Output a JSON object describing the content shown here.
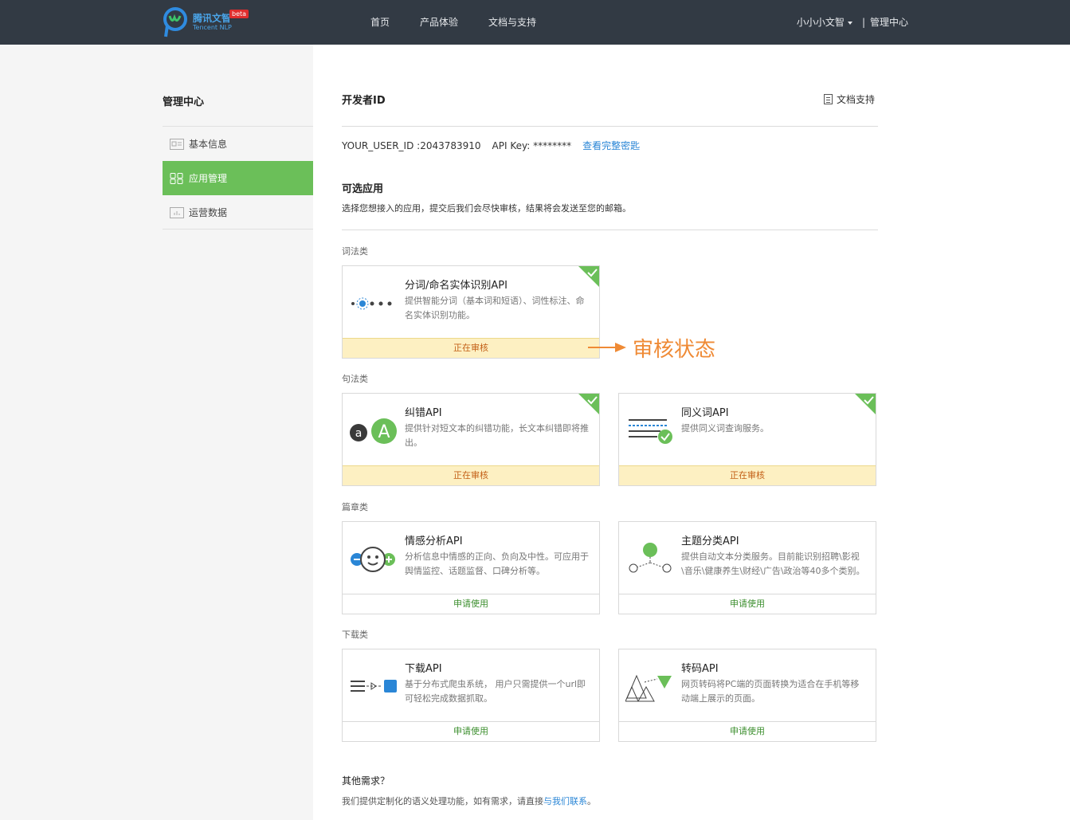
{
  "header": {
    "logo_text": "腾讯文智",
    "logo_sub": "Tencent NLP",
    "logo_badge": "beta",
    "nav": [
      "首页",
      "产品体验",
      "文档与支持"
    ],
    "username": "小小小文智",
    "separator": "|",
    "admin_link": "管理中心"
  },
  "sidebar": {
    "title": "管理中心",
    "items": [
      {
        "label": "基本信息",
        "icon": "id-card-icon"
      },
      {
        "label": "应用管理",
        "icon": "grid-icon"
      },
      {
        "label": "运营数据",
        "icon": "chart-icon"
      }
    ]
  },
  "content": {
    "title": "开发者ID",
    "doc_link": "文档支持",
    "user_id": "YOUR_USER_ID :2043783910",
    "api_key": "API Key: ********",
    "view_key": "查看完整密匙",
    "section_title": "可选应用",
    "section_desc": "选择您想接入的应用，提交后我们会尽快审核，结果将会发送至您的邮箱。",
    "categories": [
      "词法类",
      "句法类",
      "篇章类",
      "下载类"
    ],
    "cards": [
      {
        "title": "分词/命名实体识别API",
        "desc": "提供智能分词（基本词和短语）、词性标注、命名实体识别功能。",
        "footer": "正在审核",
        "pending": true,
        "icon": "segmentation-icon"
      },
      {
        "title": "纠错API",
        "desc": "提供针对短文本的纠错功能，长文本纠错即将推出。",
        "footer": "正在审核",
        "pending": true,
        "icon": "correction-icon"
      },
      {
        "title": "同义词API",
        "desc": "提供同义词查询服务。",
        "footer": "正在审核",
        "pending": true,
        "icon": "synonym-icon"
      },
      {
        "title": "情感分析API",
        "desc": "分析信息中情感的正向、负向及中性。可应用于舆情监控、话题监督、口碑分析等。",
        "footer": "申请使用",
        "pending": false,
        "icon": "sentiment-icon"
      },
      {
        "title": "主题分类API",
        "desc": "提供自动文本分类服务。目前能识别招聘\\影视\\音乐\\健康养生\\财经\\广告\\政治等40多个类别。",
        "footer": "申请使用",
        "pending": false,
        "icon": "topic-icon"
      },
      {
        "title": "下载API",
        "desc": "基于分布式爬虫系统， 用户只需提供一个url即可轻松完成数据抓取。",
        "footer": "申请使用",
        "pending": false,
        "icon": "download-icon"
      },
      {
        "title": "转码API",
        "desc": "网页转码将PC端的页面转换为适合在手机等移动端上展示的页面。",
        "footer": "申请使用",
        "pending": false,
        "icon": "transcode-icon"
      }
    ],
    "annotation": "审核状态",
    "other_title": "其他需求？",
    "other_desc": "我们提供定制化的语义处理功能，如有需求，请直接",
    "other_link": "与我们联系",
    "other_end": "。"
  },
  "colors": {
    "topbar": "#323a44",
    "accent_green": "#6bbf59",
    "link_blue": "#2a86d6",
    "pending_bg": "#fdf0c2",
    "annotation": "#ef8a35"
  }
}
